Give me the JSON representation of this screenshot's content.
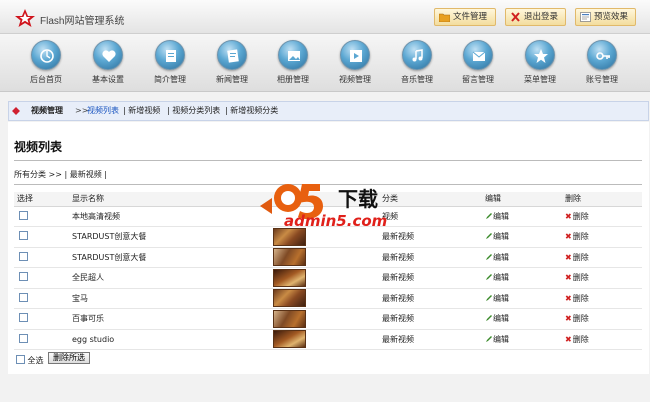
{
  "app": {
    "title": "Flash网站管理系统"
  },
  "header_buttons": [
    {
      "label": "文件管理",
      "icon": "folder-icon"
    },
    {
      "label": "退出登录",
      "icon": "close-icon"
    },
    {
      "label": "预览效果",
      "icon": "preview-icon"
    }
  ],
  "nav": [
    {
      "label": "后台首页",
      "icon": "home-icon"
    },
    {
      "label": "基本设置",
      "icon": "heart-icon"
    },
    {
      "label": "简介管理",
      "icon": "profile-icon"
    },
    {
      "label": "新闻管理",
      "icon": "news-icon"
    },
    {
      "label": "相册管理",
      "icon": "album-icon"
    },
    {
      "label": "视频管理",
      "icon": "video-icon"
    },
    {
      "label": "音乐管理",
      "icon": "music-icon"
    },
    {
      "label": "留言管理",
      "icon": "mail-icon"
    },
    {
      "label": "菜单管理",
      "icon": "star-icon"
    },
    {
      "label": "账号管理",
      "icon": "key-icon"
    }
  ],
  "breadcrumb": {
    "section": "视频管理",
    "sep": ">>",
    "items": [
      "视频列表",
      "| 新增视频",
      "| 视频分类列表",
      "| 新增视频分类"
    ]
  },
  "page": {
    "title": "视频列表",
    "filter": "所有分类  >>  |  最新视频  |"
  },
  "table": {
    "headers": [
      "选择",
      "显示名称",
      "",
      "分类",
      "编辑",
      "删除"
    ],
    "rows": [
      {
        "name": "本地高清视频",
        "category": "视频",
        "edit": "编辑",
        "delete": "删除"
      },
      {
        "name": "STARDUST创意大餐",
        "category": "最新视频",
        "edit": "编辑",
        "delete": "删除"
      },
      {
        "name": "STARDUST创意大餐",
        "category": "最新视频",
        "edit": "编辑",
        "delete": "删除"
      },
      {
        "name": "全民超人",
        "category": "最新视频",
        "edit": "编辑",
        "delete": "删除"
      },
      {
        "name": "宝马",
        "category": "最新视频",
        "edit": "编辑",
        "delete": "删除"
      },
      {
        "name": "百事可乐",
        "category": "最新视频",
        "edit": "编辑",
        "delete": "删除"
      },
      {
        "name": "egg studio",
        "category": "最新视频",
        "edit": "编辑",
        "delete": "删除"
      }
    ]
  },
  "footer": {
    "select_all": "全选",
    "delete_selected": "删除所选"
  },
  "watermark": {
    "brand": "a5下载",
    "url": "admin5.com"
  },
  "colors": {
    "accent": "#1a55c0",
    "delete": "#d02020",
    "edit": "#3a8a2a",
    "header_button": "#f3dd9e"
  }
}
